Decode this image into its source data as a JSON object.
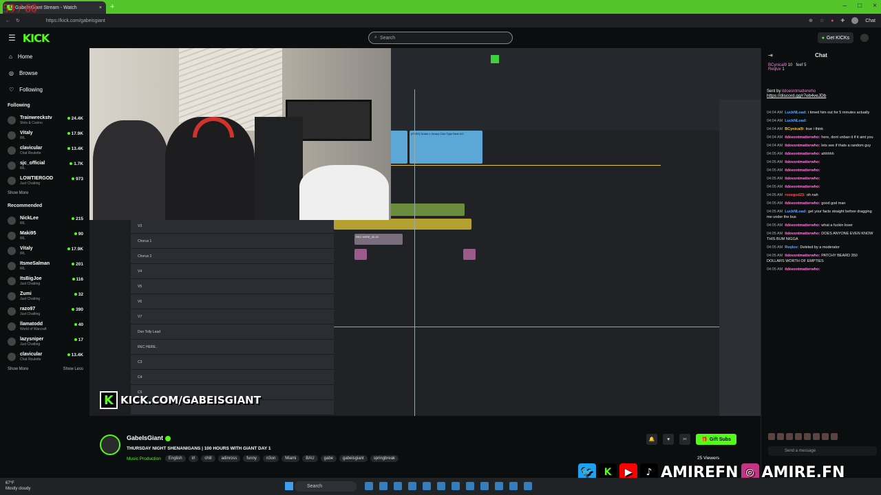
{
  "browser": {
    "tab_title": "GabeIsGiant Stream - Watch",
    "fps_overlay": "59 / 60",
    "url": "https://kick.com/gabeisgiant",
    "chat_label": "Chat"
  },
  "header": {
    "logo": "KICK",
    "search_placeholder": "Search",
    "get_kicks": "Get KICKs"
  },
  "sidebar": {
    "nav": [
      {
        "label": "Home",
        "icon": "home-icon"
      },
      {
        "label": "Browse",
        "icon": "compass-icon"
      },
      {
        "label": "Following",
        "icon": "heart-icon"
      }
    ],
    "following_title": "Following",
    "following": [
      {
        "name": "Trainwreckstv",
        "category": "Slots & Casino",
        "viewers": "24.4K"
      },
      {
        "name": "Vitaly",
        "category": "IRL",
        "viewers": "17.9K"
      },
      {
        "name": "clavicular",
        "category": "Chat Roulette",
        "viewers": "13.4K"
      },
      {
        "name": "sjc_official",
        "category": "IRL",
        "viewers": "1.7K"
      },
      {
        "name": "LOWTIERGOD",
        "category": "Just Chatting",
        "viewers": "973"
      }
    ],
    "show_more": "Show More",
    "recommended_title": "Recommended",
    "recommended": [
      {
        "name": "NickLee",
        "category": "IRL",
        "viewers": "215"
      },
      {
        "name": "Maki95",
        "category": "IRL",
        "viewers": "90"
      },
      {
        "name": "Vitaly",
        "category": "IRL",
        "viewers": "17.9K"
      },
      {
        "name": "ItsmeSalman",
        "category": "IRL",
        "viewers": "201"
      },
      {
        "name": "ItsBigJoe",
        "category": "Just Chatting",
        "viewers": "116"
      },
      {
        "name": "Zumi",
        "category": "Just Chatting",
        "viewers": "32"
      },
      {
        "name": "razo97",
        "category": "Just Chatting",
        "viewers": "390"
      },
      {
        "name": "llamatodd",
        "category": "World of Warcraft",
        "viewers": "40"
      },
      {
        "name": "lazysniper",
        "category": "Just Chatting",
        "viewers": "17"
      },
      {
        "name": "clavicular",
        "category": "Chat Roulette",
        "viewers": "13.4K"
      }
    ],
    "show_more_2": "Show More",
    "show_less": "Show Less"
  },
  "video": {
    "watermark": "KICK.COM/GABEISGIANT",
    "watermark_logo": "K",
    "tracks": [
      "V3",
      "Chorus 1",
      "Chorus 2",
      "V4",
      "V5",
      "V6",
      "V7",
      "Don Tolly Lead",
      "REC HERE..",
      "C3",
      "C4",
      "C5"
    ],
    "clip_label_1": "Beat DON'T CALL ANYMORE-01",
    "clip_label_2": "(FREE) Drake x Jersey Club Type Beat DO",
    "clip_label_3": "REC HERE_32-01",
    "groups_label": "GROUPS"
  },
  "chat": {
    "title": "Chat",
    "leaderboard": [
      {
        "name": "BCynical9",
        "value": "10"
      },
      {
        "name": "feef",
        "value": "5"
      },
      {
        "name": "Reqluv",
        "value": "1"
      }
    ],
    "pinned_by": "Sent by",
    "pinned_user": "itdoesntmatterwho",
    "pinned_link": "https://discord.gg/r7eb4veJDb",
    "messages": [
      {
        "time": "04:04 AM",
        "user": "LuckNLoad:",
        "color": "b",
        "text": "i timed him out for 5 minutes actually"
      },
      {
        "time": "04:04 AM",
        "user": "LuckNLoad:",
        "color": "b",
        "text": ""
      },
      {
        "time": "04:04 AM",
        "user": "BCynical9:",
        "color": "y",
        "text": "true i think"
      },
      {
        "time": "04:04 AM",
        "user": "itdoesntmatterwho:",
        "color": "",
        "text": "here, dont unban it if it aint you"
      },
      {
        "time": "04:04 AM",
        "user": "itdoesntmatterwho:",
        "color": "",
        "text": "lets see if thats a random guy"
      },
      {
        "time": "04:05 AM",
        "user": "itdoesntmatterwho:",
        "color": "",
        "text": "ahhhhh"
      },
      {
        "time": "04:05 AM",
        "user": "itdoesntmatterwho:",
        "color": "",
        "text": ""
      },
      {
        "time": "04:05 AM",
        "user": "itdoesntmatterwho:",
        "color": "",
        "text": ""
      },
      {
        "time": "04:05 AM",
        "user": "itdoesntmatterwho:",
        "color": "",
        "text": ""
      },
      {
        "time": "04:05 AM",
        "user": "itdoesntmatterwho:",
        "color": "",
        "text": ""
      },
      {
        "time": "04:05 AM",
        "user": "rosegod23:",
        "color": "r",
        "text": "oh nah"
      },
      {
        "time": "04:05 AM",
        "user": "itdoesntmatterwho:",
        "color": "",
        "text": "good god man"
      },
      {
        "time": "04:05 AM",
        "user": "LuckNLoad:",
        "color": "b",
        "text": "get your facts straight before dragging me under the bus"
      },
      {
        "time": "04:05 AM",
        "user": "itdoesntmatterwho:",
        "color": "",
        "text": "what a fuckin loser"
      },
      {
        "time": "04:05 AM",
        "user": "itdoesntmatterwho:",
        "color": "",
        "text": "DOES ANYONE EVEN KNOW THIS BUM NIGGA"
      },
      {
        "time": "04:05 AM",
        "user": "Reqluv:",
        "color": "b",
        "text": "Deleted by a moderator"
      },
      {
        "time": "04:05 AM",
        "user": "itdoesntmatterwho:",
        "color": "",
        "text": "PATCHY BEARD 350 DOLLARS WORTH OF EMPTIES"
      },
      {
        "time": "04:05 AM",
        "user": "itdoesntmatterwho:",
        "color": "",
        "text": ""
      }
    ],
    "send_placeholder": "Send a message"
  },
  "stream": {
    "name": "GabeIsGiant",
    "title": "THURSDAY NIGHT SHENANIGANS | 100 HOURS WITH GIANT DAY 1",
    "category": "Music Production",
    "tags": [
      "English",
      "irl",
      "chill",
      "adinross",
      "funny",
      "n3on",
      "Miami",
      "BAU",
      "gabe",
      "gabeisgiant",
      "springbreak"
    ],
    "gift_subs": "Gift Subs",
    "viewers": "25 Viewers"
  },
  "overlay_socials": {
    "handle1": "AMIREFN",
    "handle2": "AMIRE.FN"
  },
  "taskbar": {
    "weather_temp": "67°F",
    "weather_desc": "Mostly cloudy",
    "search": "Search"
  },
  "colors": {
    "kick_green": "#53fc18",
    "browser_green": "#53c52a"
  }
}
